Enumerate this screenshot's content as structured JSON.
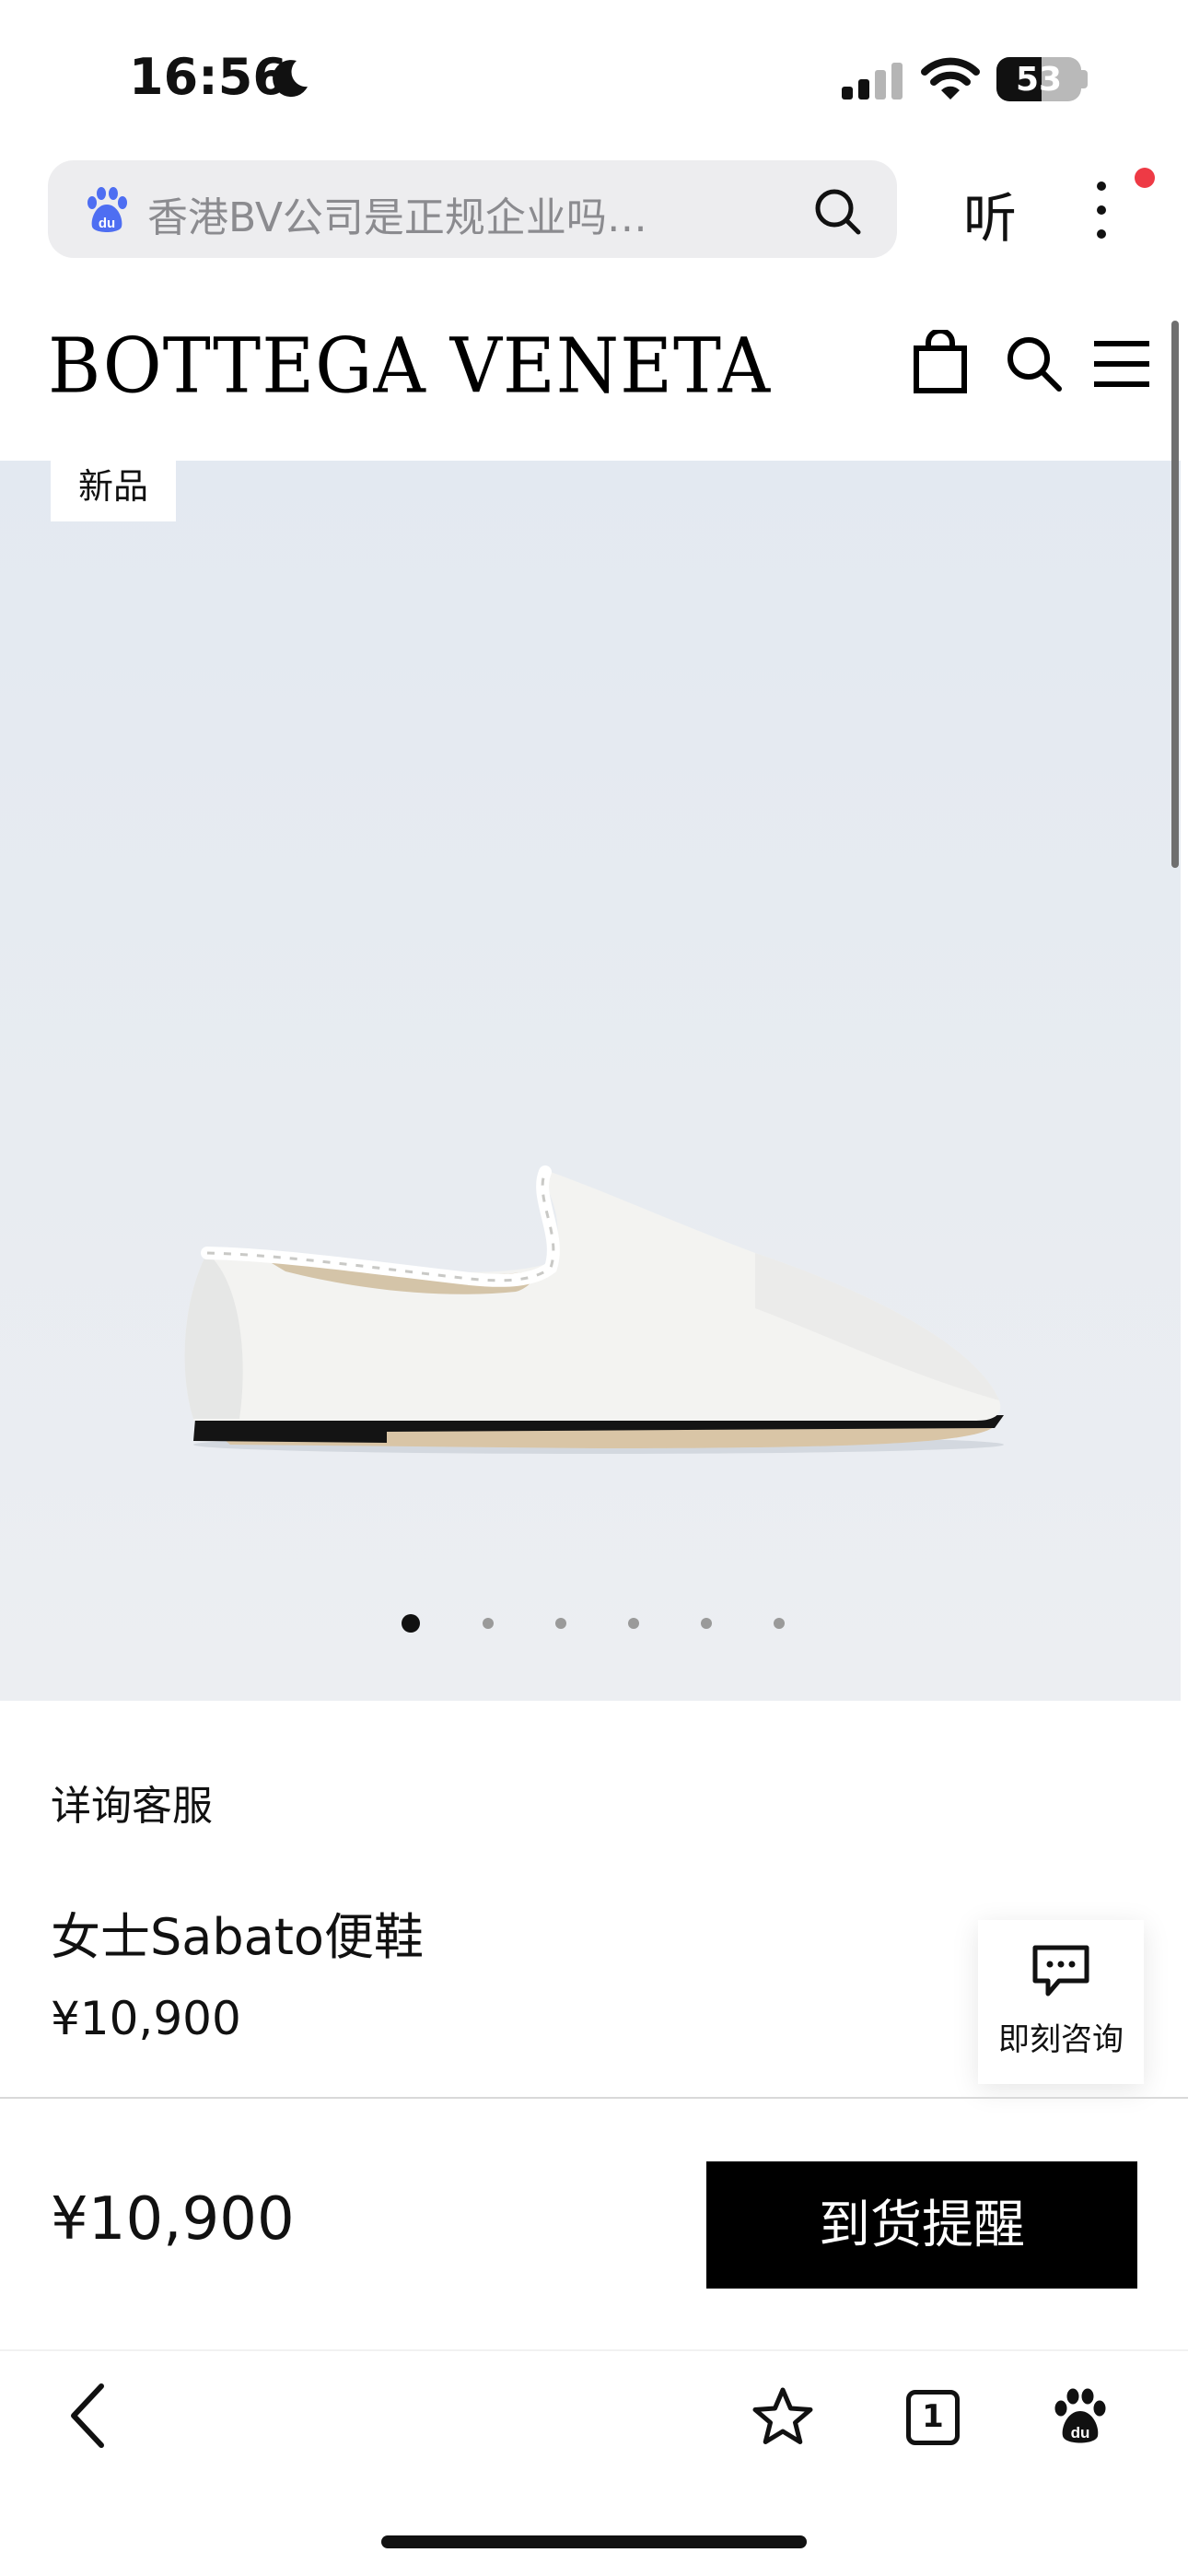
{
  "status_bar": {
    "time": "16:56",
    "battery": "53"
  },
  "browser": {
    "search_text": "香港BV公司是正规企业吗…",
    "listen_label": "听",
    "tab_count": "1"
  },
  "site": {
    "brand": "BOTTEGA VENETA"
  },
  "product": {
    "badge": "新品",
    "consult_label": "详询客服",
    "name": "女士Sabato便鞋",
    "price": "¥10,900",
    "image_count": 6,
    "active_image": 0
  },
  "chat": {
    "label": "即刻咨询"
  },
  "buy_bar": {
    "price": "¥10,900",
    "notify_label": "到货提醒"
  },
  "colors": {
    "accent": "#000000",
    "notification": "#ee3a45",
    "baidu_blue": "#4e6ef2"
  }
}
